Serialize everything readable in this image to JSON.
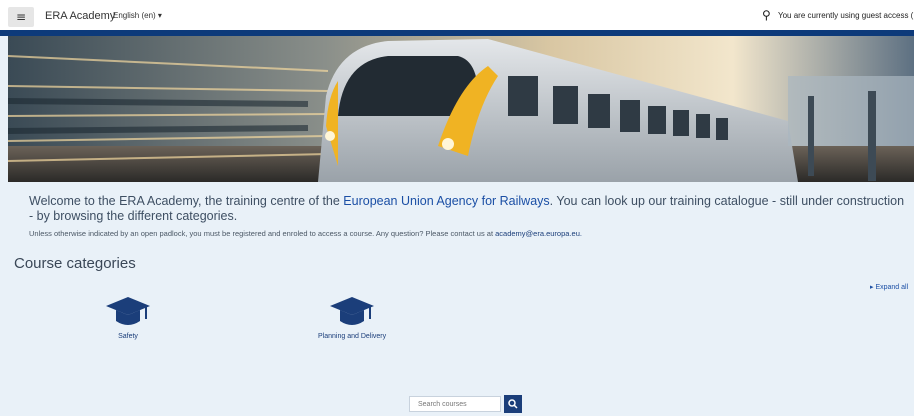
{
  "header": {
    "menu_icon": "hamburger-icon",
    "site_name": "ERA Academy",
    "language": "English (en) ▾",
    "search_icon": "search-icon",
    "guest_text": "You are currently using guest access (Log in)"
  },
  "hero": {
    "image": "high-speed train banner"
  },
  "welcome": {
    "part1": "Welcome to the ERA Academy, the training centre of the ",
    "agency_link": "European Union Agency for Railways",
    "part2": ". You can look up our training catalogue - still under construction - by browsing the different categories.",
    "note": "Unless otherwise indicated by an open padlock, you must be registered and enroled to access a course. Any question? Please contact us at ",
    "email": "academy@era.europa.eu."
  },
  "categories": {
    "heading": "Course categories",
    "expand_all": "▸ Expand all",
    "items": [
      {
        "label": "Safety",
        "icon": "graduation-cap-icon"
      },
      {
        "label": "Planning and Delivery",
        "icon": "graduation-cap-icon"
      }
    ]
  },
  "search": {
    "placeholder": "Search courses"
  },
  "colors": {
    "brand_blue": "#0d3a7a",
    "link_blue": "#1b4fa5",
    "page_bg": "#e9f1f8"
  }
}
